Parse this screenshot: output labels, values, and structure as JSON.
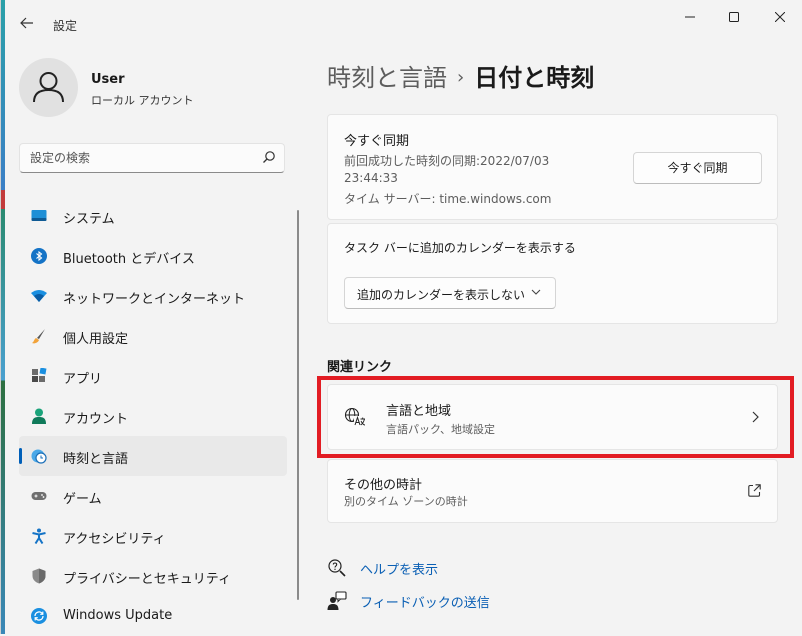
{
  "window": {
    "title": "設定"
  },
  "profile": {
    "name": "User",
    "account_type": "ローカル アカウント"
  },
  "search": {
    "placeholder": "設定の検索"
  },
  "sidebar": {
    "items": [
      {
        "label": "システム",
        "icon": "system-icon"
      },
      {
        "label": "Bluetooth とデバイス",
        "icon": "bluetooth-icon"
      },
      {
        "label": "ネットワークとインターネット",
        "icon": "wifi-icon"
      },
      {
        "label": "個人用設定",
        "icon": "brush-icon"
      },
      {
        "label": "アプリ",
        "icon": "apps-icon"
      },
      {
        "label": "アカウント",
        "icon": "account-icon"
      },
      {
        "label": "時刻と言語",
        "icon": "time-language-icon",
        "active": true
      },
      {
        "label": "ゲーム",
        "icon": "gamepad-icon"
      },
      {
        "label": "アクセシビリティ",
        "icon": "accessibility-icon"
      },
      {
        "label": "プライバシーとセキュリティ",
        "icon": "shield-icon"
      },
      {
        "label": "Windows Update",
        "icon": "update-icon"
      }
    ]
  },
  "breadcrumb": {
    "parent": "時刻と言語",
    "separator": "›",
    "current": "日付と時刻"
  },
  "sync": {
    "title": "今すぐ同期",
    "last_sync_line1": "前回成功した時刻の同期:2022/07/03",
    "last_sync_line2": "23:44:33",
    "server": "タイム サーバー: time.windows.com",
    "button": "今すぐ同期"
  },
  "calendar": {
    "label": "タスク バーに追加のカレンダーを表示する",
    "selected": "追加のカレンダーを表示しない"
  },
  "related": {
    "heading": "関連リンク",
    "language_region": {
      "title": "言語と地域",
      "subtitle": "言語パック、地域設定"
    },
    "other_clocks": {
      "title": "その他の時計",
      "subtitle": "別のタイム ゾーンの時計"
    }
  },
  "help": {
    "get_help": "ヘルプを表示",
    "feedback": "フィードバックの送信"
  },
  "colors": {
    "accent": "#005fb8",
    "highlight": "#e21c23",
    "link": "#0a5fb4"
  }
}
